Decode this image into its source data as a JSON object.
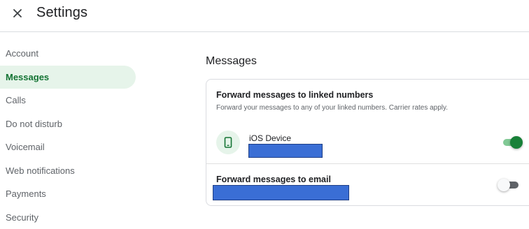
{
  "header": {
    "title": "Settings",
    "close_icon": "close-icon"
  },
  "sidebar": {
    "items": [
      {
        "label": "Account",
        "active": false
      },
      {
        "label": "Messages",
        "active": true
      },
      {
        "label": "Calls",
        "active": false
      },
      {
        "label": "Do not disturb",
        "active": false
      },
      {
        "label": "Voicemail",
        "active": false
      },
      {
        "label": "Web notifications",
        "active": false
      },
      {
        "label": "Payments",
        "active": false
      },
      {
        "label": "Security",
        "active": false
      }
    ]
  },
  "main": {
    "section_title": "Messages",
    "forward_numbers": {
      "title": "Forward messages to linked numbers",
      "description": "Forward your messages to any of your linked numbers. Carrier rates apply.",
      "device": {
        "name": "iOS Device",
        "icon": "phone-icon",
        "enabled": true
      }
    },
    "forward_email": {
      "title": "Forward messages to email",
      "enabled": false
    }
  },
  "colors": {
    "accent": "#188038",
    "active_nav_bg": "#e6f4ea",
    "active_nav_text": "#137333",
    "redaction": "#3a6ed5"
  }
}
